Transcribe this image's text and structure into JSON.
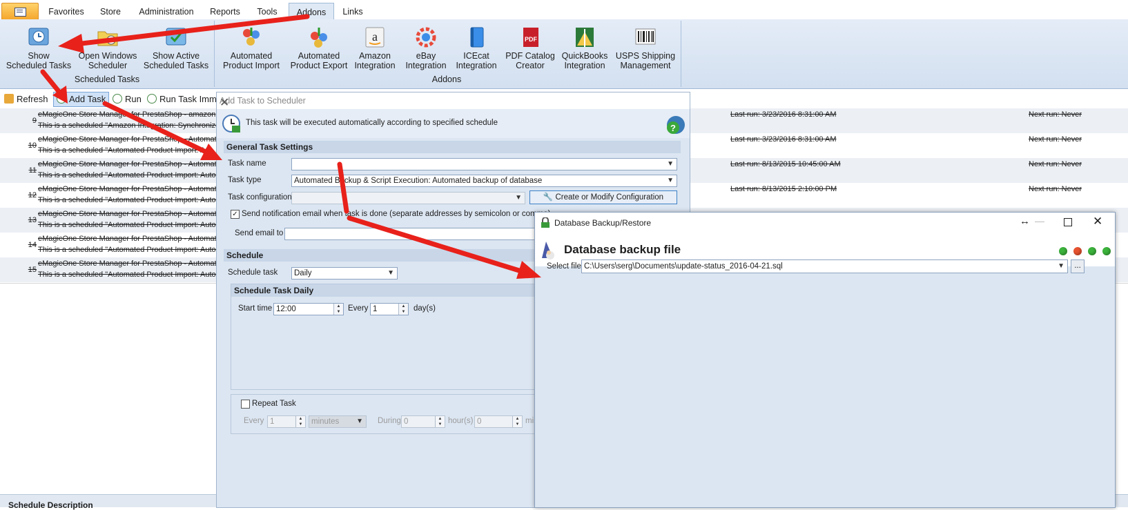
{
  "ribbon_tabs": [
    "Favorites",
    "Store",
    "Administration",
    "Reports",
    "Tools",
    "Addons",
    "Links"
  ],
  "active_tab": "Addons",
  "ribbon": {
    "scheduled": {
      "group_label": "Scheduled Tasks",
      "buttons": [
        {
          "line1": "Show",
          "line2": "Scheduled Tasks"
        },
        {
          "line1": "Open Windows",
          "line2": "Scheduler"
        },
        {
          "line1": "Show Active",
          "line2": "Scheduled Tasks"
        }
      ]
    },
    "addons": {
      "group_label": "Addons",
      "buttons": [
        {
          "line1": "Automated",
          "line2": "Product Import"
        },
        {
          "line1": "Automated",
          "line2": "Product Export"
        },
        {
          "line1": "Amazon",
          "line2": "Integration"
        },
        {
          "line1": "eBay",
          "line2": "Integration"
        },
        {
          "line1": "ICEcat",
          "line2": "Integration"
        },
        {
          "line1": "PDF Catalog",
          "line2": "Creator"
        },
        {
          "line1": "QuickBooks",
          "line2": "Integration"
        },
        {
          "line1": "USPS Shipping",
          "line2": "Management"
        }
      ]
    }
  },
  "toolbar": {
    "refresh": "Refresh",
    "add_task": "Add Task",
    "run": "Run",
    "run_immediately": "Run Task Imm"
  },
  "tasks": [
    {
      "num": "9",
      "line1": "eMagicOne Store Manager for PrestaShop - amazon",
      "line2": "This is a scheduled \"Amazon Integration: Synchronize",
      "last_run": "Last run: 3/23/2016 8:31:00 AM",
      "next_run": "Next run: Never"
    },
    {
      "num": "10",
      "line1": "eMagicOne Store Manager for PrestaShop - Automate",
      "line2": "This is a scheduled \"Automated Product Import: Au",
      "last_run": "Last run: 3/23/2016 8:31:00 AM",
      "next_run": "Next run: Never"
    },
    {
      "num": "11",
      "line1": "eMagicOne Store Manager for PrestaShop - Automate",
      "line2": "This is a scheduled \"Automated Product Import: Autom",
      "last_run": "Last run: 8/13/2015 10:45:00 AM",
      "next_run": "Next run: Never"
    },
    {
      "num": "12",
      "line1": "eMagicOne Store Manager for PrestaShop - Automate",
      "line2": "This is a scheduled \"Automated Product Import: Autom",
      "last_run": "Last run: 8/13/2015 2:10:00 PM",
      "next_run": "Next run: Never"
    },
    {
      "num": "13",
      "line1": "eMagicOne Store Manager for PrestaShop - Automate",
      "line2": "This is a scheduled \"Automated Product Import: Autom",
      "last_run": "",
      "next_run": ""
    },
    {
      "num": "14",
      "line1": "eMagicOne Store Manager for PrestaShop - Automate",
      "line2": "This is a scheduled \"Automated Product Import: Autom",
      "last_run": "",
      "next_run": ""
    },
    {
      "num": "15",
      "line1": "eMagicOne Store Manager for PrestaShop - Automate",
      "line2": "This is a scheduled \"Automated Product Import: Autom",
      "last_run": "",
      "next_run": ""
    }
  ],
  "bottom_panel_title": "Schedule Description",
  "add_task_dialog": {
    "title": "Add Task to Scheduler",
    "info": "This task will be executed automatically according to specified schedule",
    "general_section": "General Task Settings",
    "task_name_label": "Task name",
    "task_name_value": "",
    "task_type_label": "Task type",
    "task_type_value": "Automated Backup & Script Execution: Automated backup of database",
    "task_config_label": "Task configuration",
    "task_config_value": "",
    "config_button": "Create or Modify Configuration",
    "notify_label": "Send notification email when task is done (separate addresses by semicolon or comma)",
    "notify_checked": true,
    "send_email_label": "Send email to",
    "send_email_value": "",
    "schedule_section": "Schedule",
    "schedule_task_label": "Schedule task",
    "schedule_task_value": "Daily",
    "daily_section": "Schedule Task Daily",
    "start_time_label": "Start time",
    "start_time_value": "12:00",
    "every_label": "Every",
    "every_value": "1",
    "days_label": "day(s)",
    "repeat_label": "Repeat Task",
    "repeat_checked": false,
    "repeat_every_label": "Every",
    "repeat_every_value": "1",
    "repeat_unit": "minutes",
    "during_label": "During",
    "during_value": "0",
    "hours_label": "hour(s)",
    "minutes_value": "0",
    "minutes_label_partial": "mi"
  },
  "db_dialog": {
    "title": "Database Backup/Restore",
    "heading": "Database backup file",
    "select_file_label": "Select file",
    "select_file_value": "C:\\Users\\serg\\Documents\\update-status_2016-04-21.sql",
    "browse_label": "...",
    "status_colors": [
      "#3cb43c",
      "#e8532f",
      "#3cb43c",
      "#3cb43c"
    ]
  },
  "colors": {
    "arrow": "#e8211b",
    "ribbon_bg": "#dfe9f5",
    "accent": "#3c7fc6"
  }
}
